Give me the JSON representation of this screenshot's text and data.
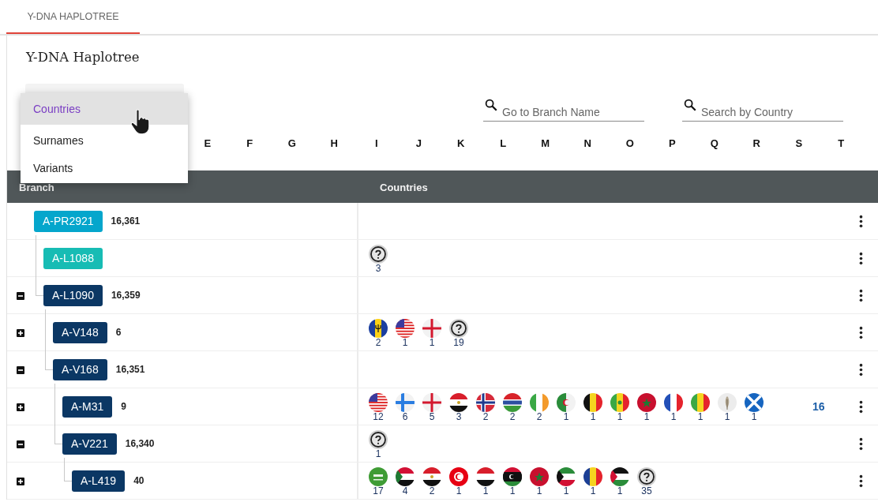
{
  "tab": {
    "label": "Y-DNA HAPLOTREE",
    "selected": true
  },
  "title": "Y-DNA Haplotree",
  "view_menu": {
    "items": [
      {
        "label": "Countries",
        "selected": true
      },
      {
        "label": "Surnames",
        "selected": false
      },
      {
        "label": "Variants",
        "selected": false
      }
    ]
  },
  "searches": [
    {
      "placeholder": "Go to Branch Name"
    },
    {
      "placeholder": "Search by Country"
    }
  ],
  "letters": [
    "E",
    "F",
    "G",
    "H",
    "I",
    "J",
    "K",
    "L",
    "M",
    "N",
    "O",
    "P",
    "Q",
    "R",
    "S",
    "T"
  ],
  "table": {
    "columns": [
      "Branch",
      "Countries"
    ],
    "tree": [
      {
        "name": "A-PR2921",
        "count": "16,361",
        "color": "#05a6cc",
        "children": [
          {
            "name": "A-L1088",
            "color": "#17bcb4",
            "countries": [
              {
                "kind": "unknown",
                "count": "3"
              }
            ]
          },
          {
            "name": "A-L1090",
            "count": "16,359",
            "color": "#0b3764",
            "expanded": true,
            "children": [
              {
                "name": "A-V148",
                "count": "6",
                "color": "#0b3764",
                "expanded": false,
                "countries": [
                  {
                    "kind": "bb",
                    "count": "2"
                  },
                  {
                    "kind": "us",
                    "count": "1"
                  },
                  {
                    "kind": "england",
                    "count": "1"
                  },
                  {
                    "kind": "unknown",
                    "count": "19"
                  }
                ]
              },
              {
                "name": "A-V168",
                "count": "16,351",
                "color": "#0b3764",
                "expanded": true,
                "children": [
                  {
                    "name": "A-M31",
                    "count": "9",
                    "color": "#0b3764",
                    "expanded": false,
                    "more": "16",
                    "countries": [
                      {
                        "kind": "us",
                        "count": "12"
                      },
                      {
                        "kind": "fi",
                        "count": "6"
                      },
                      {
                        "kind": "england",
                        "count": "5"
                      },
                      {
                        "kind": "eg",
                        "count": "3"
                      },
                      {
                        "kind": "no",
                        "count": "2"
                      },
                      {
                        "kind": "gm",
                        "count": "2"
                      },
                      {
                        "kind": "ie",
                        "count": "2"
                      },
                      {
                        "kind": "dz",
                        "count": "1"
                      },
                      {
                        "kind": "be",
                        "count": "1"
                      },
                      {
                        "kind": "sn",
                        "count": "1"
                      },
                      {
                        "kind": "ma",
                        "count": "1"
                      },
                      {
                        "kind": "fr",
                        "count": "1"
                      },
                      {
                        "kind": "ml",
                        "count": "1"
                      },
                      {
                        "kind": "feather",
                        "count": "1"
                      },
                      {
                        "kind": "scotland",
                        "count": "1"
                      }
                    ]
                  },
                  {
                    "name": "A-V221",
                    "count": "16,340",
                    "color": "#0b3764",
                    "expanded": true,
                    "countries": [
                      {
                        "kind": "unknown",
                        "count": "1"
                      }
                    ],
                    "children": [
                      {
                        "name": "A-L419",
                        "count": "40",
                        "color": "#0b3764",
                        "expanded": false,
                        "countries": [
                          {
                            "kind": "sa",
                            "count": "17"
                          },
                          {
                            "kind": "sd",
                            "count": "4"
                          },
                          {
                            "kind": "eg",
                            "count": "2"
                          },
                          {
                            "kind": "tn",
                            "count": "1"
                          },
                          {
                            "kind": "ye",
                            "count": "1"
                          },
                          {
                            "kind": "ly",
                            "count": "1"
                          },
                          {
                            "kind": "ma",
                            "count": "1"
                          },
                          {
                            "kind": "kw",
                            "count": "1"
                          },
                          {
                            "kind": "td",
                            "count": "1"
                          },
                          {
                            "kind": "ps",
                            "count": "1"
                          },
                          {
                            "kind": "unknown",
                            "count": "35"
                          }
                        ]
                      }
                    ]
                  }
                ]
              }
            ]
          }
        ]
      }
    ]
  }
}
